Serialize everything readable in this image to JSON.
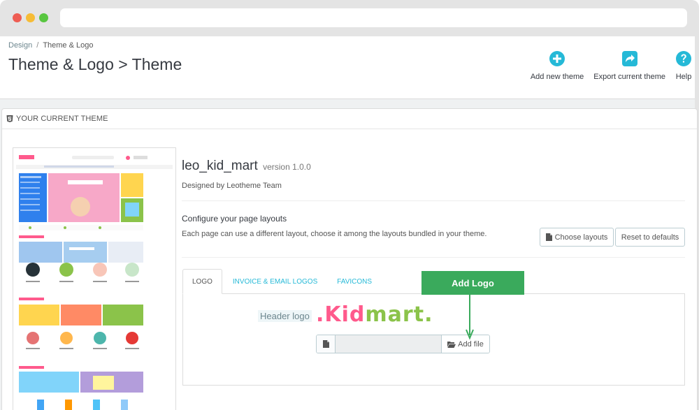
{
  "breadcrumb": {
    "first": "Design",
    "separator": "/",
    "current": "Theme & Logo"
  },
  "page": {
    "title": "Theme & Logo > Theme"
  },
  "toolbar": {
    "add_new_theme": "Add new theme",
    "export_current_theme": "Export current theme",
    "help": "Help"
  },
  "panel": {
    "heading": "YOUR CURRENT THEME"
  },
  "theme": {
    "name": "leo_kid_mart",
    "version": "version 1.0.0",
    "designer": "Designed by Leotheme Team"
  },
  "layouts": {
    "title": "Configure your page layouts",
    "description": "Each page can use a different layout, choose it among the layouts bundled in your theme.",
    "choose_label": "Choose layouts",
    "reset_label": "Reset to defaults"
  },
  "tabs": [
    {
      "label": "LOGO"
    },
    {
      "label": "INVOICE & EMAIL LOGOS"
    },
    {
      "label": "FAVICONS"
    }
  ],
  "logo_tab": {
    "header_logo_label": "Header logo",
    "logo_text": {
      "prefix": ".",
      "kid": "Kid",
      "mart": "mart",
      "suffix": "."
    },
    "file_value": "",
    "add_file_label": "Add file"
  },
  "annotation": {
    "label": "Add Logo"
  },
  "colors": {
    "accent": "#25b9d7",
    "annotation_green": "#3aaa5c",
    "logo_pink": "#ff5a8c",
    "logo_green": "#8bc34a"
  },
  "icons": {
    "add_new_theme": "plus-circle-icon",
    "export_current_theme": "share-icon",
    "help": "question-circle-icon",
    "panel_heading": "html5-icon",
    "choose_layouts": "file-icon",
    "file_input": "file-icon",
    "add_file": "folder-open-icon"
  }
}
